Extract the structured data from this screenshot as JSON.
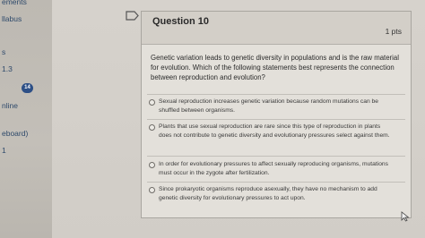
{
  "sidebar": {
    "items": [
      {
        "label": "ements"
      },
      {
        "label": "llabus"
      },
      {
        "label": "s"
      },
      {
        "label": "1.3"
      },
      {
        "label": "nline"
      },
      {
        "label": "eboard)"
      },
      {
        "label": "1"
      }
    ],
    "badge": "14"
  },
  "question": {
    "title": "Question 10",
    "points": "1 pts",
    "text": "Genetic variation leads to genetic diversity in populations and is the raw material for evolution. Which of the following statements best represents the connection between reproduction and evolution?",
    "answers": [
      {
        "text": "Sexual reproduction increases genetic variation because random mutations can be shuffled between organisms."
      },
      {
        "text": "Plants that use sexual reproduction are rare since this type of reproduction in plants does not contribute to genetic diversity and evolutionary pressures select against them."
      },
      {
        "text": "In order for evolutionary pressures to affect sexually reproducing organisms, mutations must occur in the zygote after fertilization."
      },
      {
        "text": "Since prokaryotic organisms reproduce asexually, they have no mechanism to add genetic diversity for evolutionary pressures to act upon."
      }
    ]
  }
}
